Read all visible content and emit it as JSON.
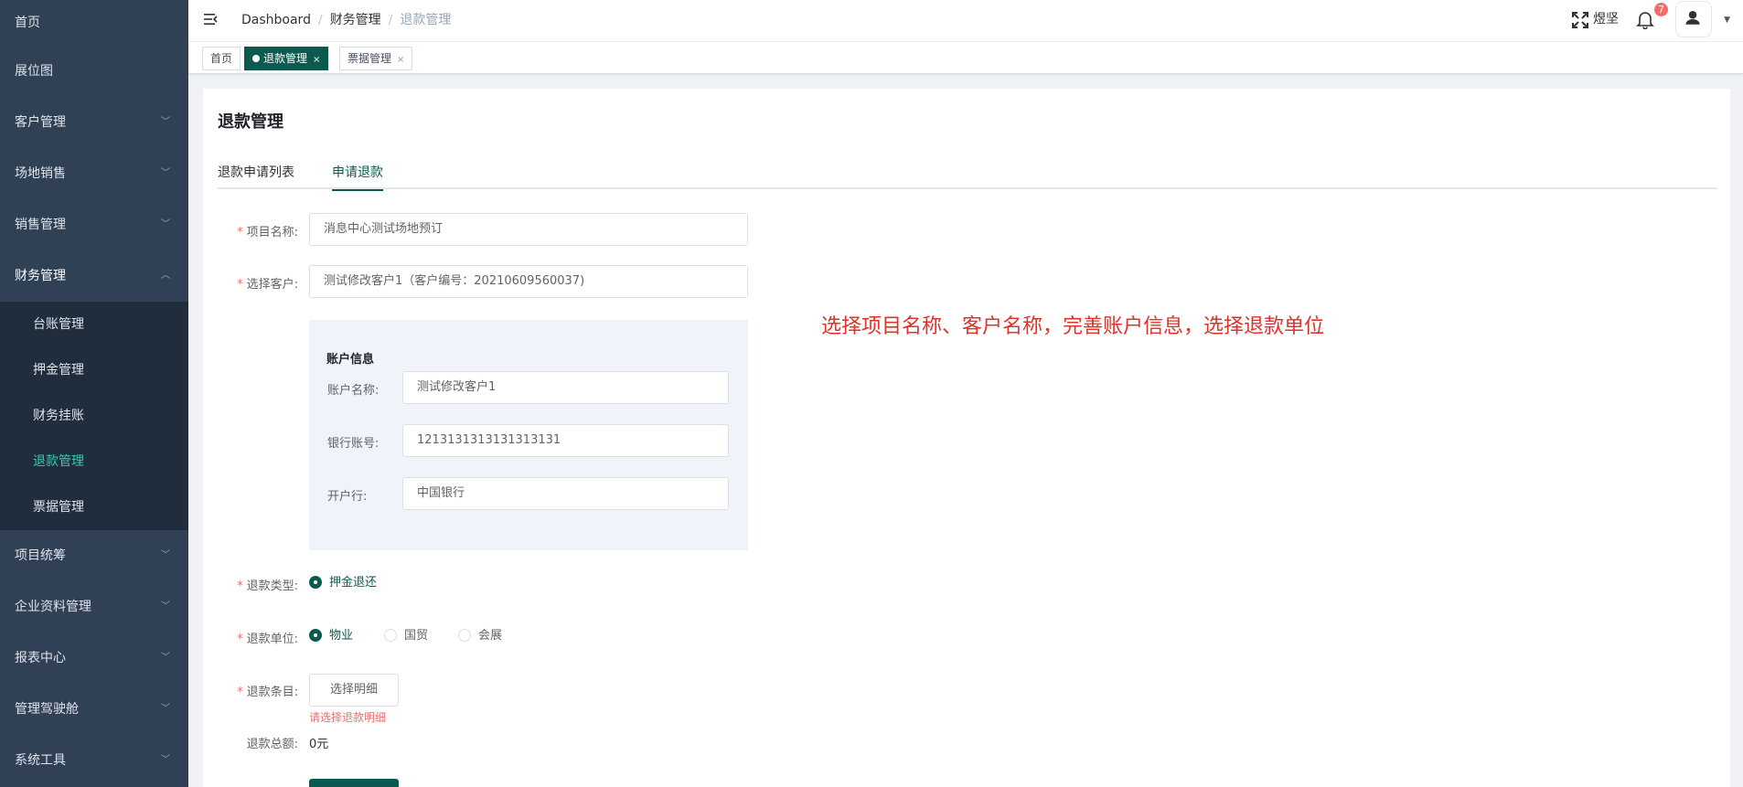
{
  "sidebar": {
    "items": [
      {
        "label": "首页",
        "has_children": false
      },
      {
        "label": "展位图",
        "has_children": false
      },
      {
        "label": "客户管理",
        "has_children": true
      },
      {
        "label": "场地销售",
        "has_children": true
      },
      {
        "label": "销售管理",
        "has_children": true
      },
      {
        "label": "财务管理",
        "has_children": true,
        "open": true
      }
    ],
    "submenu": [
      {
        "label": "台账管理"
      },
      {
        "label": "押金管理"
      },
      {
        "label": "财务挂账"
      },
      {
        "label": "退款管理",
        "active": true
      },
      {
        "label": "票据管理"
      }
    ],
    "items_after": [
      {
        "label": "项目统筹"
      },
      {
        "label": "企业资料管理"
      },
      {
        "label": "报表中心"
      },
      {
        "label": "管理驾驶舱"
      },
      {
        "label": "系统工具"
      }
    ]
  },
  "header": {
    "breadcrumb": [
      "Dashboard",
      "财务管理",
      "退款管理"
    ],
    "username": "煜坚",
    "notification_count": "7"
  },
  "tags": [
    {
      "label": "首页",
      "active": false,
      "closable": false
    },
    {
      "label": "退款管理",
      "active": true,
      "closable": true
    },
    {
      "label": "票据管理",
      "active": false,
      "closable": true
    }
  ],
  "page": {
    "title": "退款管理",
    "tabs": [
      "退款申请列表",
      "申请退款"
    ],
    "active_tab": "申请退款"
  },
  "form": {
    "project_label": "项目名称:",
    "project_value": "消息中心测试场地预订",
    "customer_label": "选择客户:",
    "customer_value": "测试修改客户1（客户编号：20210609560037)",
    "account": {
      "title": "账户信息",
      "name_label": "账户名称:",
      "name_value": "测试修改客户1",
      "bank_no_label": "银行账号:",
      "bank_no_value": "1213131313131313131",
      "bank_label": "开户行:",
      "bank_value": "中国银行"
    },
    "refund_type_label": "退款类型:",
    "refund_type_options": [
      "押金退还"
    ],
    "refund_unit_label": "退款单位:",
    "refund_unit_options": [
      "物业",
      "国贸",
      "会展"
    ],
    "refund_item_label": "退款条目:",
    "select_detail_button": "选择明细",
    "error_tip": "请选择退款明细",
    "total_label": "退款总额:",
    "total_value": "0元"
  },
  "annotation": "选择项目名称、客户名称，完善账户信息，选择退款单位",
  "colors": {
    "sidebar_bg": "#304156",
    "submenu_bg": "#1f2d3d",
    "accent": "#0b5a4f",
    "active_menu_text": "#3ec7b4",
    "required": "#f56c6c",
    "annotation": "#e0312b"
  }
}
